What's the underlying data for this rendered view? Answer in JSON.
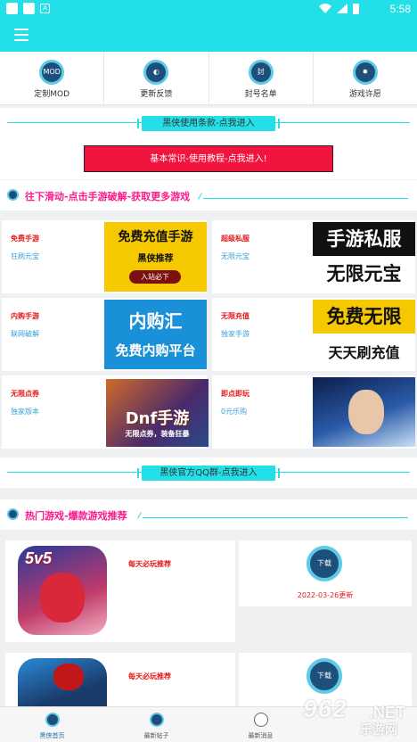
{
  "status_bar": {
    "time": "5:58",
    "icons": [
      "app-notification-icon",
      "app-notification-icon",
      "a-box-icon",
      "wifi-icon",
      "signal-icon",
      "battery-icon"
    ]
  },
  "app_bar": {
    "menu_icon": "menu-icon"
  },
  "quick_nav": [
    {
      "label": "定制MOD",
      "icon_text": "MOD",
      "icon": "mod-icon"
    },
    {
      "label": "更新反馈",
      "icon_text": "",
      "icon": "feedback-icon"
    },
    {
      "label": "封号名单",
      "icon_text": "封",
      "icon": "ban-list-icon"
    },
    {
      "label": "游戏许愿",
      "icon_text": "",
      "icon": "wish-icon"
    }
  ],
  "terms_link": "黑侠使用条款-点我进入",
  "tutorial_button": "基本常识-使用教程-点我进入!",
  "section1_title": "往下滑动-点击手游破解-获取更多游戏",
  "promo_cards": [
    {
      "title": "免费手游",
      "subtitle": "狂刷元宝",
      "thumb": {
        "line1": "免费充值手游",
        "line2": "黑侠推荐",
        "line3": "入站必下"
      }
    },
    {
      "title": "超级私服",
      "subtitle": "无限元宝",
      "thumb": {
        "line1": "手游私服",
        "line2": "无限元宝"
      }
    },
    {
      "title": "内购手游",
      "subtitle": "联网破解",
      "thumb": {
        "line1": "内购汇",
        "line2": "免费内购平台"
      }
    },
    {
      "title": "无限充值",
      "subtitle": "独家手游",
      "thumb": {
        "line1": "免费无限",
        "line2": "天天刷充值"
      }
    },
    {
      "title": "无限点券",
      "subtitle": "独家版本",
      "thumb": {
        "line1": "Dnf手游",
        "line2": "无限点券，装备狂暴"
      }
    },
    {
      "title": "即点即玩",
      "subtitle": "0元乐购",
      "thumb": {}
    }
  ],
  "qq_group_link": "黑侠官方QQ群-点我进入",
  "section2_title": "热门游戏-爆款游戏推荐",
  "games": [
    {
      "tag": "每天必玩推荐",
      "icon_text": "5v5",
      "download_label": "下载",
      "update": "2022-03-26更新"
    },
    {
      "tag": "每天必玩推荐",
      "icon_text": "",
      "download_label": "下载",
      "update": ""
    }
  ],
  "tab_bar": [
    {
      "label": "黑侠首页",
      "active": true
    },
    {
      "label": "最新帖子",
      "active": false
    },
    {
      "label": "最新消息",
      "active": false
    },
    {
      "label": "",
      "active": false
    }
  ],
  "watermark": {
    "num": "962",
    "net": ".NET",
    "cn": "乐游网"
  }
}
